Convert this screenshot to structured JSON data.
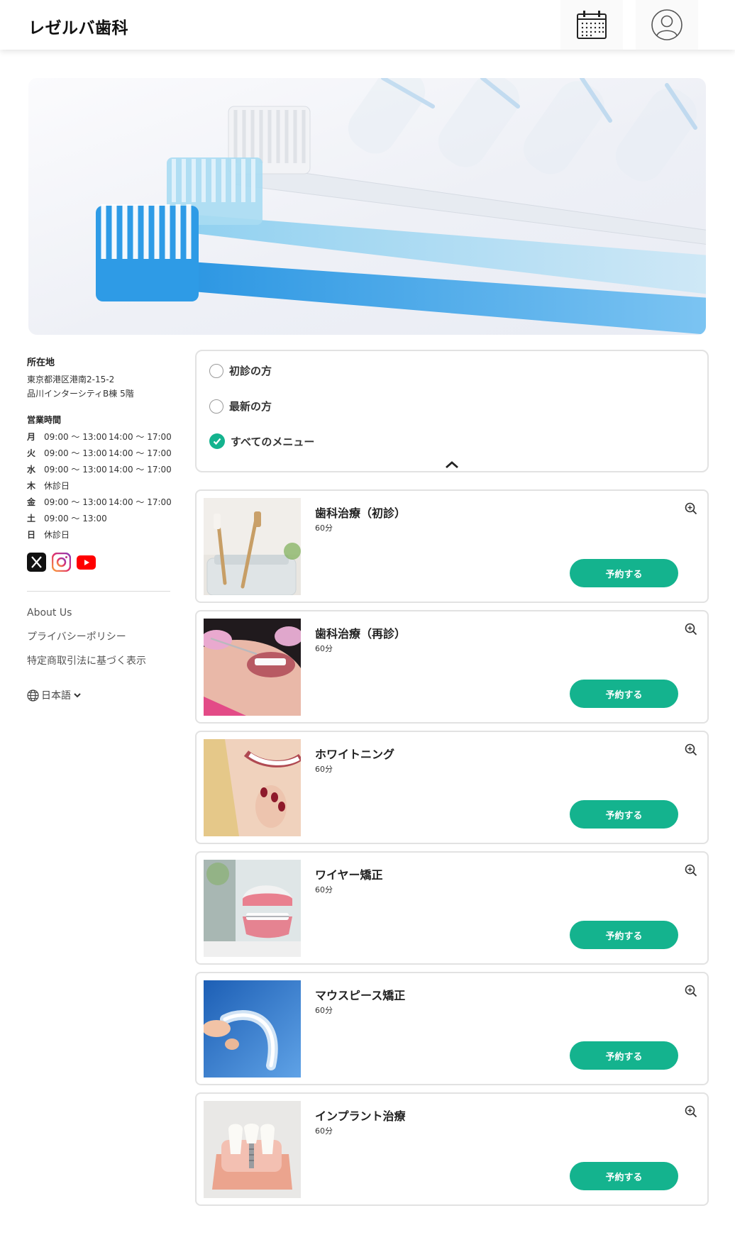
{
  "header": {
    "logo": "レゼルバ歯科",
    "calendar_icon": "calendar-icon",
    "user_icon": "user-account-icon"
  },
  "sidebar": {
    "location_title": "所在地",
    "address_line1": "東京都港区港南2-15-2",
    "address_line2": "品川インターシティB棟 5階",
    "hours_title": "営業時間",
    "hours": [
      {
        "day": "月",
        "am": "09:00 ～ 13:00",
        "pm": "14:00 ～ 17:00"
      },
      {
        "day": "火",
        "am": "09:00 ～ 13:00",
        "pm": "14:00 ～ 17:00"
      },
      {
        "day": "水",
        "am": "09:00 ～ 13:00",
        "pm": "14:00 ～ 17:00"
      },
      {
        "day": "木",
        "am": "休診日",
        "pm": ""
      },
      {
        "day": "金",
        "am": "09:00 ～ 13:00",
        "pm": "14:00 ～ 17:00"
      },
      {
        "day": "土",
        "am": "09:00 ～ 13:00",
        "pm": ""
      },
      {
        "day": "日",
        "am": "休診日",
        "pm": ""
      }
    ],
    "social": [
      "x-icon",
      "instagram-icon",
      "youtube-icon"
    ],
    "links": [
      "About Us",
      "プライバシーポリシー",
      "特定商取引法に基づく表示"
    ],
    "language": "日本語"
  },
  "filter": {
    "options": [
      {
        "label": "初診の方",
        "checked": false
      },
      {
        "label": "最新の方",
        "checked": false
      },
      {
        "label": "すべてのメニュー",
        "checked": true
      }
    ]
  },
  "menu": [
    {
      "title": "歯科治療（初診）",
      "duration": "60分",
      "button": "予約する"
    },
    {
      "title": "歯科治療（再診）",
      "duration": "60分",
      "button": "予約する"
    },
    {
      "title": "ホワイトニング",
      "duration": "60分",
      "button": "予約する"
    },
    {
      "title": "ワイヤー矯正",
      "duration": "60分",
      "button": "予約する"
    },
    {
      "title": "マウスピース矯正",
      "duration": "60分",
      "button": "予約する"
    },
    {
      "title": "インプラント治療",
      "duration": "60分",
      "button": "予約する"
    }
  ],
  "colors": {
    "accent": "#14b38e",
    "border": "#e2e2e2"
  }
}
